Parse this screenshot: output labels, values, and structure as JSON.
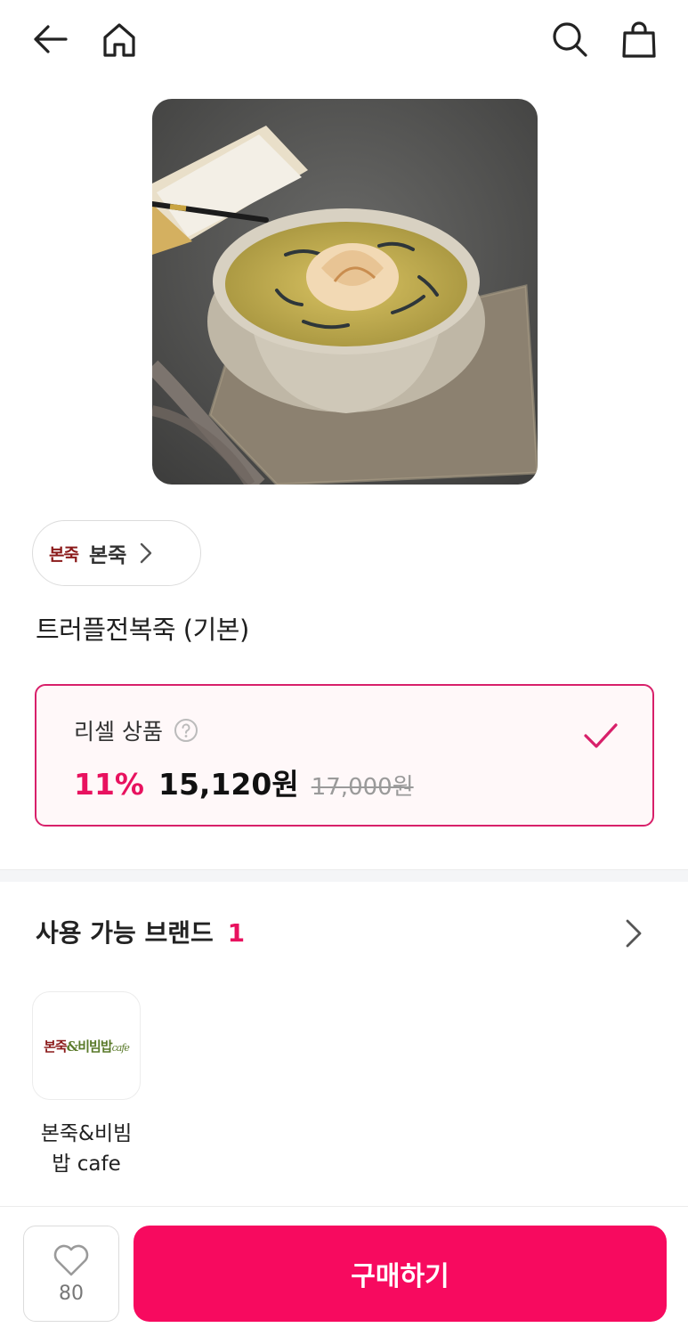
{
  "header": {
    "back_icon": "arrow-left-icon",
    "home_icon": "home-icon",
    "search_icon": "search-icon",
    "cart_icon": "shopping-bag-icon"
  },
  "product": {
    "image_alt": "",
    "brand_logo_text": "본죽",
    "brand_name": "본죽",
    "title": "트러플전복죽 (기본)"
  },
  "option": {
    "label": "리셀 상품",
    "discount": "11%",
    "price": "15,120원",
    "original_price": "17,000원",
    "selected": true
  },
  "brands_section": {
    "title": "사용 가능 브랜드",
    "count": "1",
    "items": [
      {
        "logo_part1": "본죽",
        "logo_part2": "&비빔밥",
        "logo_part3": "cafe",
        "name": "본죽&비빔밥 cafe"
      }
    ]
  },
  "bottom_bar": {
    "like_count": "80",
    "buy_label": "구매하기"
  },
  "colors": {
    "accent": "#e8125f",
    "buy_button": "#f70a5f",
    "card_border": "#d8206a",
    "brand_logo": "#8b1a1a"
  }
}
